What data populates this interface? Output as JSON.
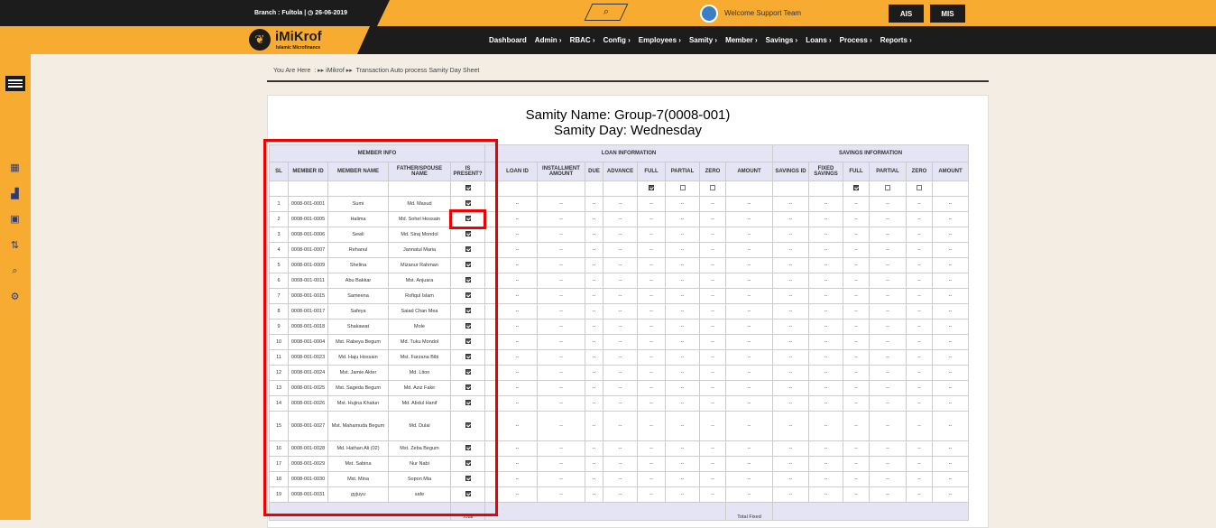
{
  "topbar": {
    "branch": "Branch : Fultola |",
    "date": "26-06-2019",
    "welcome": "Welcome Support Team",
    "ais": "AIS",
    "mis": "MIS"
  },
  "logo": {
    "name": "iMiKrof",
    "subtitle": "Islamic Microfinance"
  },
  "menu": [
    "Dashboard",
    "Admin ›",
    "RBAC ›",
    "Config ›",
    "Employees ›",
    "Samity ›",
    "Member ›",
    "Savings ›",
    "Loans ›",
    "Process ›",
    "Reports ›"
  ],
  "breadcrumb": {
    "you_are_here": "You Are Here",
    "root": "iMikrof",
    "current": "Transaction Auto process Samity Day Sheet"
  },
  "sheet": {
    "samity_name": "Samity Name: Group-7(0008-001)",
    "samity_day": "Samity Day: Wednesday"
  },
  "table": {
    "groups": [
      "MEMBER INFO",
      "LOAN INFORMATION",
      "SAVINGS INFORMATION"
    ],
    "headers": [
      "SL",
      "MEMBER ID",
      "MEMBER NAME",
      "FATHER/SPOUSE NAME",
      "IS PRESENT?",
      "LOAN ID",
      "INSTALLMENT AMOUNT",
      "DUE",
      "ADVANCE",
      "FULL",
      "PARTIAL",
      "ZERO",
      "AMOUNT",
      "SAVINGS ID",
      "FIXED SAVINGS",
      "FULL",
      "PARTIAL",
      "ZERO",
      "AMOUNT"
    ],
    "rows": [
      [
        "1",
        "0008-001-0001",
        "Sumi",
        "Md. Masud"
      ],
      [
        "2",
        "0008-001-0005",
        "Halima",
        "Md. Sohel Hossain"
      ],
      [
        "3",
        "0008-001-0006",
        "Sewli",
        "Md. Siraj Mondol"
      ],
      [
        "4",
        "0008-001-0007",
        "Rehanul",
        "Jannatul Maria"
      ],
      [
        "5",
        "0008-001-0009",
        "Shelina",
        "Mizanur Rahman"
      ],
      [
        "6",
        "0008-001-0011",
        "Abu Bakkar",
        "Mst. Anjuara"
      ],
      [
        "7",
        "0008-001-0015",
        "Sameena",
        "Rofiqul Islam"
      ],
      [
        "8",
        "0008-001-0017",
        "Safeya",
        "Saiad Chan Mea"
      ],
      [
        "9",
        "0008-001-0018",
        "Shakawat",
        "Mole"
      ],
      [
        "10",
        "0008-001-0004",
        "Mst. Rabeya Begum",
        "Md. Tuku Mondol"
      ],
      [
        "11",
        "0008-001-0023",
        "Md. Haju Hossain",
        "Mst. Farzana Bibi"
      ],
      [
        "12",
        "0008-001-0024",
        "Mst. Jamie Akter",
        "Md. Liton"
      ],
      [
        "13",
        "0008-001-0025",
        "Mst. Sageda Begum",
        "Md. Aziz Fakir"
      ],
      [
        "14",
        "0008-001-0026",
        "Mst. Hujina Khatun",
        "Md. Abdul Hanif"
      ],
      [
        "15",
        "0008-001-0027",
        "Mst. Mahamuda Begum",
        "Md. Dulal"
      ],
      [
        "16",
        "0008-001-0028",
        "Md. Hathan Ali (02)",
        "Mst. Zeba Begum"
      ],
      [
        "17",
        "0008-001-0029",
        "Mst. Sabina",
        "Nur Nabi"
      ],
      [
        "18",
        "0008-001-0030",
        "Mst. Mina",
        "Sopon Mia"
      ],
      [
        "19",
        "0008-001-0031",
        "gyjuyu",
        "safe"
      ]
    ],
    "dash": "--",
    "footer_total": "Total",
    "footer_total_fixed": "Total Fixed"
  }
}
